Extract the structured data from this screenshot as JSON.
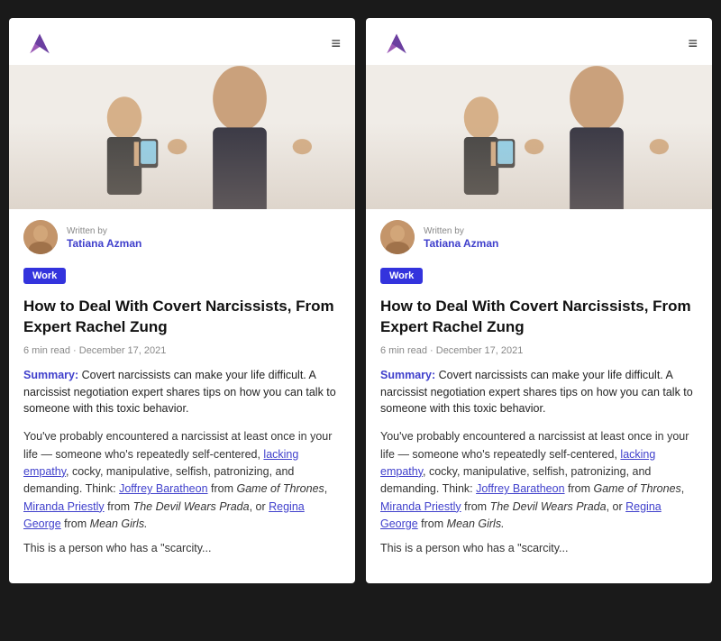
{
  "panels": [
    {
      "id": "panel-left",
      "header": {
        "logo_alt": "Brand Logo",
        "menu_label": "☰"
      },
      "hero_alt": "Woman photographing another woman",
      "author": {
        "written_by": "Written by",
        "name": "Tatiana Azman"
      },
      "tag": "Work",
      "title": "How to Deal With Covert Narcissists, From Expert Rachel Zung",
      "date": "6 min read · December 17, 2021",
      "summary_label": "Summary:",
      "summary_text": " Covert narcissists can make your life difficult. A narcissist negotiation expert shares tips on how you can talk to someone with this toxic behavior.",
      "body_paragraphs": [
        "You've probably encountered a narcissist at least once in your life — someone who's repeatedly self-centered, lacking empathy, cocky, manipulative, selfish, patronizing, and demanding. Think: Joffrey Baratheon from Game of Thrones, Miranda Priestly from The Devil Wears Prada, or Regina George from Mean Girls.",
        "This is a person who has a \"scarcity..."
      ],
      "links": [
        "lacking empathy",
        "Joffrey Baratheon",
        "Miranda Priestly",
        "Regina George"
      ],
      "italic_phrases": [
        "Game of Thrones",
        "The Devil Wears Prada",
        "Mean Girls"
      ]
    },
    {
      "id": "panel-right",
      "header": {
        "logo_alt": "Brand Logo",
        "menu_label": "☰"
      },
      "hero_alt": "Woman photographing another woman",
      "author": {
        "written_by": "Written by",
        "name": "Tatiana Azman"
      },
      "tag": "Work",
      "title": "How to Deal With Covert Narcissists, From Expert Rachel Zung",
      "date": "6 min read · December 17, 2021",
      "summary_label": "Summary:",
      "summary_text": " Covert narcissists can make your life difficult. A narcissist negotiation expert shares tips on how you can talk to someone with this toxic behavior.",
      "body_paragraphs": [
        "You've probably encountered a narcissist at least once in your life — someone who's repeatedly self-centered, lacking empathy, cocky, manipulative, selfish, patronizing, and demanding. Think: Joffrey Baratheon from Game of Thrones, Miranda Priestly from The Devil Wears Prada, or Regina George from Mean Girls.",
        "This is a person who has a \"scarcity..."
      ],
      "links": [
        "lacking empathy",
        "Joffrey Baratheon",
        "Miranda Priestly",
        "Regina George"
      ],
      "italic_phrases": [
        "Game of Thrones",
        "The Devil Wears Prada",
        "Mean Girls"
      ]
    }
  ]
}
